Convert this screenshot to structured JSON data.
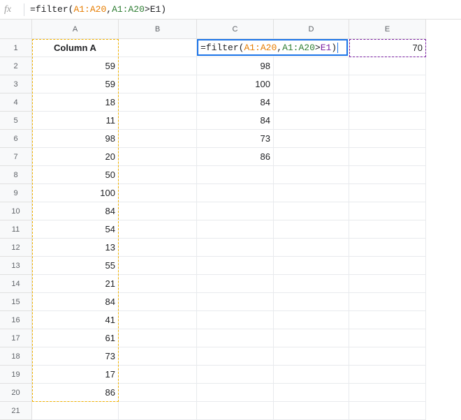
{
  "formula_bar": {
    "fx_label": "fx",
    "prefix": "=",
    "fn": "filter",
    "open": "(",
    "range1": "A1:A20",
    "comma": ",",
    "range2": "A1:A20",
    "gt": ">",
    "ref": "E1",
    "close": ")"
  },
  "col_headers": [
    "A",
    "B",
    "C",
    "D",
    "E"
  ],
  "row_headers": [
    "1",
    "2",
    "3",
    "4",
    "5",
    "6",
    "7",
    "8",
    "9",
    "10",
    "11",
    "12",
    "13",
    "14",
    "15",
    "16",
    "17",
    "18",
    "19",
    "20",
    "21"
  ],
  "colA_header": "Column A",
  "colA": [
    "59",
    "59",
    "18",
    "11",
    "98",
    "20",
    "50",
    "100",
    "84",
    "54",
    "13",
    "55",
    "21",
    "84",
    "41",
    "61",
    "73",
    "17",
    "86"
  ],
  "colC": [
    "98",
    "100",
    "84",
    "84",
    "73",
    "86"
  ],
  "E1": "70",
  "editing_cell": {
    "prefix": "=",
    "fn": "filter",
    "open": "(",
    "range1": "A1:A20",
    "comma": ",",
    "range2": "A1:A20",
    "gt": ">",
    "ref": "E1",
    "close": ")"
  },
  "chart_data": {
    "type": "table",
    "title": "",
    "columns": [
      "A",
      "B",
      "C",
      "D",
      "E"
    ],
    "cells": {
      "A1": "Column A",
      "A2": 59,
      "A3": 59,
      "A4": 18,
      "A5": 11,
      "A6": 98,
      "A7": 20,
      "A8": 50,
      "A9": 100,
      "A10": 84,
      "A11": 54,
      "A12": 13,
      "A13": 55,
      "A14": 21,
      "A15": 84,
      "A16": 41,
      "A17": 61,
      "A18": 73,
      "A19": 17,
      "A20": 86,
      "C1": "=filter(A1:A20,A1:A20>E1)",
      "C2": 98,
      "C3": 100,
      "C4": 84,
      "C5": 84,
      "C6": 73,
      "C7": 86,
      "E1": 70
    }
  }
}
